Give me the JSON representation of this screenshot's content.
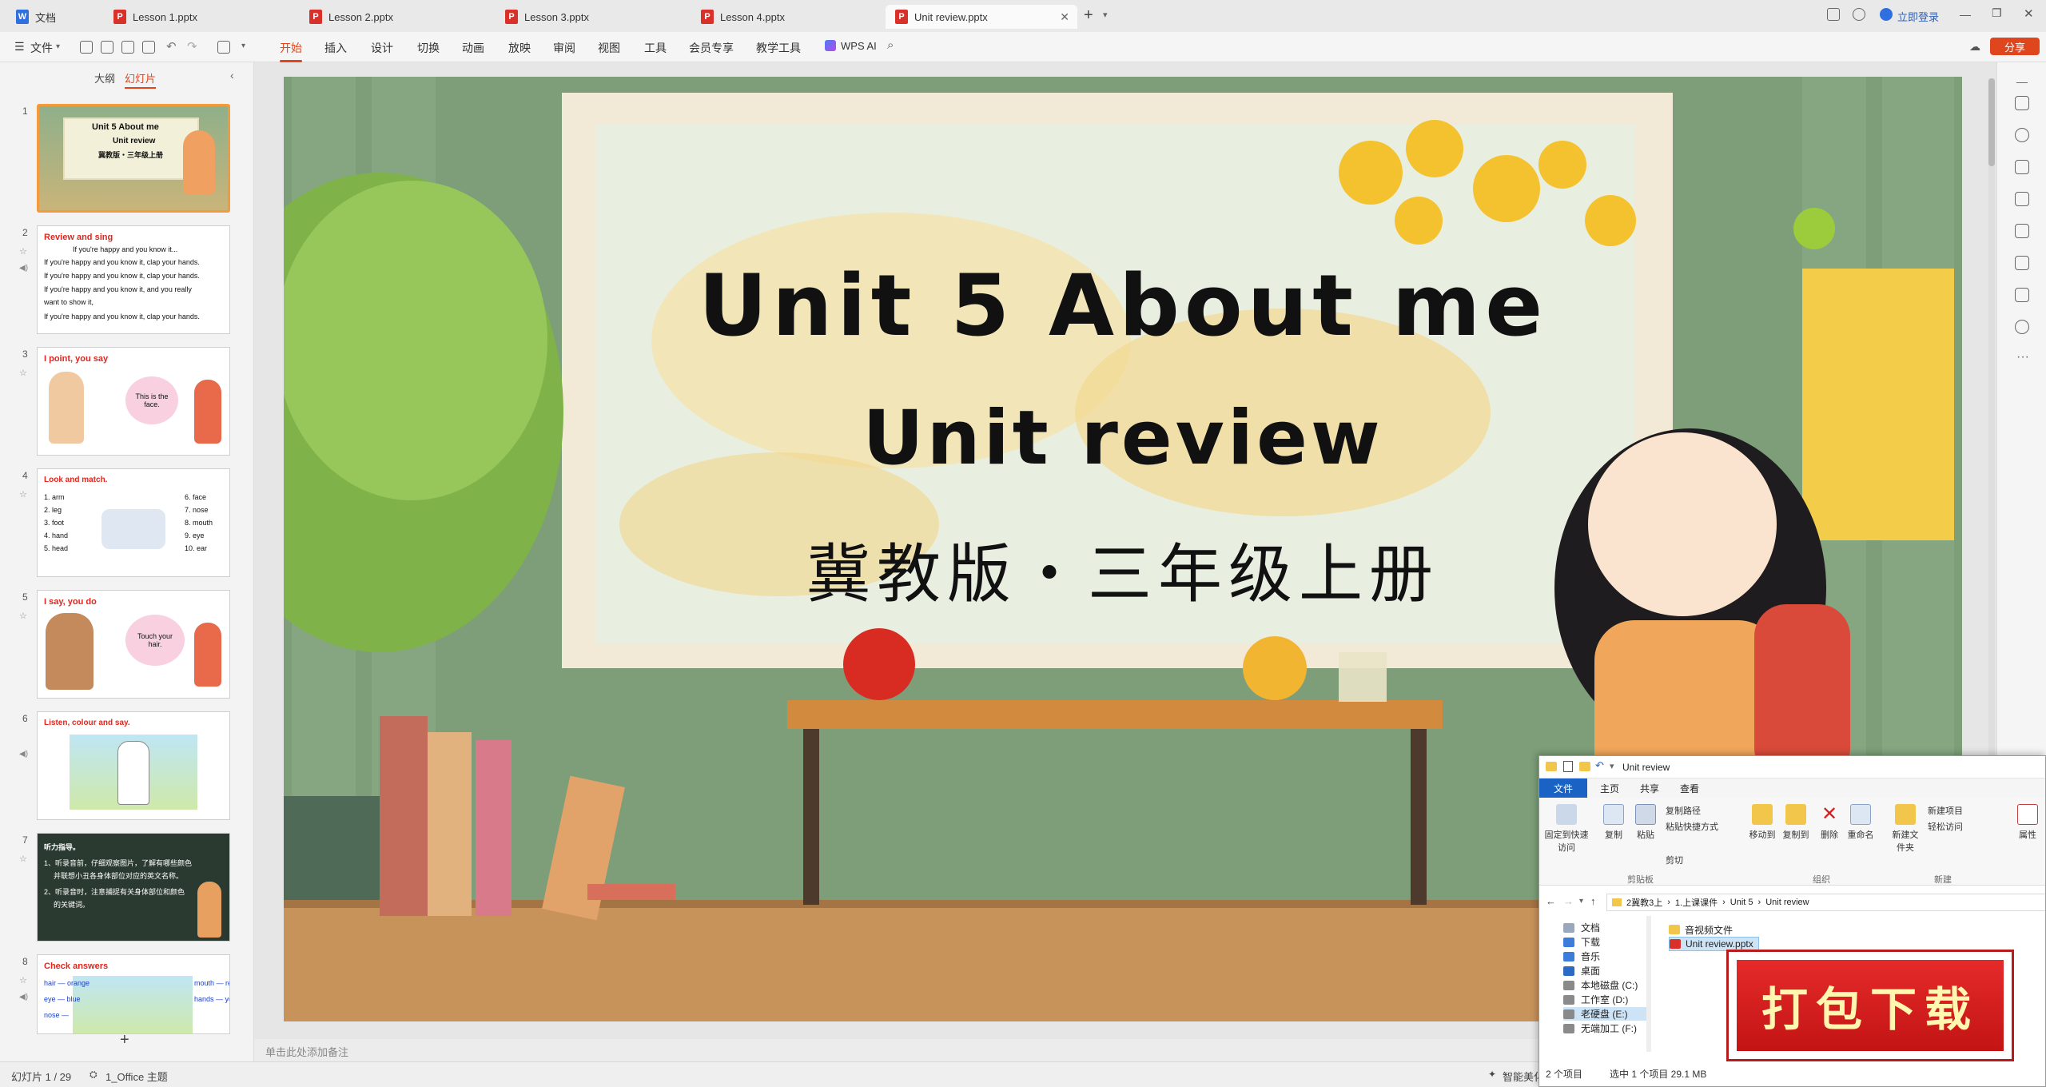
{
  "tabs": {
    "doc": "文档",
    "t1": "Lesson 1.pptx",
    "t2": "Lesson 2.pptx",
    "t3": "Lesson 3.pptx",
    "t4": "Lesson 4.pptx",
    "t5": "Unit review.pptx",
    "login": "立即登录"
  },
  "menu": {
    "file": "文件",
    "items": [
      "开始",
      "插入",
      "设计",
      "切换",
      "动画",
      "放映",
      "审阅",
      "视图",
      "工具",
      "会员专享",
      "教学工具"
    ],
    "wps_ai": "WPS AI",
    "share": "分享"
  },
  "panel": {
    "outline": "大纲",
    "slides": "幻灯片",
    "add": "+"
  },
  "thumbs": {
    "n1": "1",
    "n2": "2",
    "n3": "3",
    "n4": "4",
    "n5": "5",
    "n6": "6",
    "n7": "7",
    "n8": "8",
    "s1_title": "Unit 5 About me",
    "s1_sub": "Unit review",
    "s1_cn": "冀教版・三年级上册",
    "s2_title": "Review and sing",
    "s2_l1": "If you're happy and you know it...",
    "s2_l2": "If you're happy and you know it, clap your hands.",
    "s2_l3": "If you're happy and you know it, clap your hands.",
    "s2_l4": "If you're happy and you know it, and you really",
    "s2_l5": "want to show it,",
    "s2_l6": "If you're happy and you know it, clap your hands.",
    "s3_title": "I point, you say",
    "s3_bubble": "This is the face.",
    "s4_title": "Look and match.",
    "s4_left": [
      "1. arm",
      "2. leg",
      "3. foot",
      "4. hand",
      "5. head"
    ],
    "s4_right": [
      "6. face",
      "7. nose",
      "8. mouth",
      "9. eye",
      "10. ear"
    ],
    "s5_title": "I say, you do",
    "s5_bubble": "Touch your hair.",
    "s6_title": "Listen, colour and say.",
    "s7_l1": "听力指导。",
    "s7_l2": "1、听录音前，仔细观察图片，了解有哪些颜色",
    "s7_l3": "并联想小丑各身体部位对应的英文名称。",
    "s7_l4": "2、听录音时，注意捕捉有关身体部位和颜色",
    "s7_l5": "的关键词。",
    "s8_title": "Check answers",
    "s8_left": [
      "hair — orange",
      "eye — blue",
      "nose —"
    ],
    "s8_right": [
      "mouth — red",
      "hands — yellow"
    ]
  },
  "slide": {
    "title": "Unit 5 About me",
    "subtitle": "Unit review",
    "cn": "冀教版・三年级上册"
  },
  "notes_placeholder": "单击此处添加备注",
  "status": {
    "slide_count": "幻灯片 1 / 29",
    "theme": "1_Office 主题",
    "smart": "智能美化"
  },
  "explorer": {
    "title": "Unit review",
    "tab_file": "文件",
    "tab_home": "主页",
    "tab_share": "共享",
    "tab_view": "查看",
    "btn_pin": "固定到快速访问",
    "btn_copy": "复制",
    "btn_paste": "粘贴",
    "copy_path": "复制路径",
    "paste_shortcut": "粘贴快捷方式",
    "cut": "剪切",
    "clipboard": "剪贴板",
    "move_to": "移动到",
    "copy_to": "复制到",
    "delete": "删除",
    "rename": "重命名",
    "organize": "组织",
    "new_folder": "新建文件夹",
    "new_item": "新建项目",
    "easy_access": "轻松访问",
    "new_group": "新建",
    "properties": "属性",
    "breadcrumb": [
      "2冀教3上",
      "1.上课课件",
      "Unit 5",
      "Unit review"
    ],
    "nav": [
      "文档",
      "下载",
      "音乐",
      "桌面",
      "本地磁盘 (C:)",
      "工作室 (D:)",
      "老硬盘 (E:)",
      "无端加工 (F:)"
    ],
    "files": [
      "音视频文件",
      "Unit review.pptx"
    ],
    "status_items": "2 个项目",
    "status_sel": "选中 1 个项目  29.1 MB"
  },
  "download_label": "打包下载"
}
